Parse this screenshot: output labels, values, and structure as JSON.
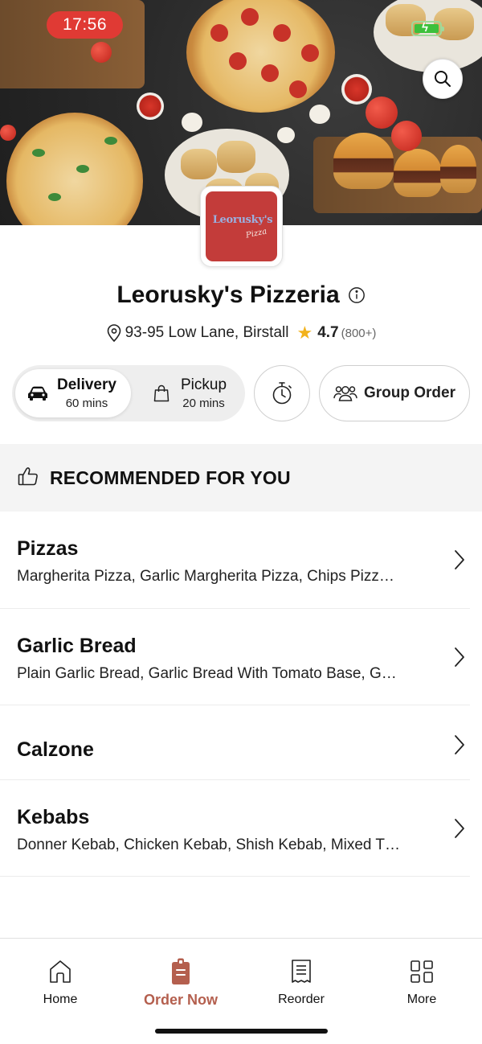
{
  "status_bar": {
    "time": "17:56"
  },
  "restaurant": {
    "logo_text_main": "Leorusky's",
    "logo_text_sub": "Pizza",
    "name": "Leorusky's Pizzeria",
    "address": "93-95 Low Lane, Birstall",
    "rating": "4.7",
    "rating_count": "(800+)"
  },
  "order_mode": {
    "delivery": {
      "label": "Delivery",
      "time": "60 mins",
      "selected": true
    },
    "pickup": {
      "label": "Pickup",
      "time": "20 mins",
      "selected": false
    },
    "group_order_label": "Group Order"
  },
  "recommended": {
    "label": "RECOMMENDED FOR YOU"
  },
  "categories": [
    {
      "name": "Pizzas",
      "description": "Margherita Pizza, Garlic Margherita Pizza, Chips Pizz…"
    },
    {
      "name": "Garlic Bread",
      "description": "Plain Garlic Bread, Garlic Bread With Tomato Base, G…"
    },
    {
      "name": "Calzone",
      "description": ""
    },
    {
      "name": "Kebabs",
      "description": "Donner Kebab, Chicken Kebab, Shish Kebab, Mixed T…"
    }
  ],
  "tabs": [
    {
      "label": "Home",
      "icon": "home-icon"
    },
    {
      "label": "Order Now",
      "icon": "order-bag-icon",
      "active": true
    },
    {
      "label": "Reorder",
      "icon": "receipt-icon"
    },
    {
      "label": "More",
      "icon": "grid-icon"
    }
  ],
  "colors": {
    "accent": "#b45f4e",
    "time_pill": "#e03a34",
    "star": "#f2b21b",
    "logo_bg": "#c33c3a"
  }
}
